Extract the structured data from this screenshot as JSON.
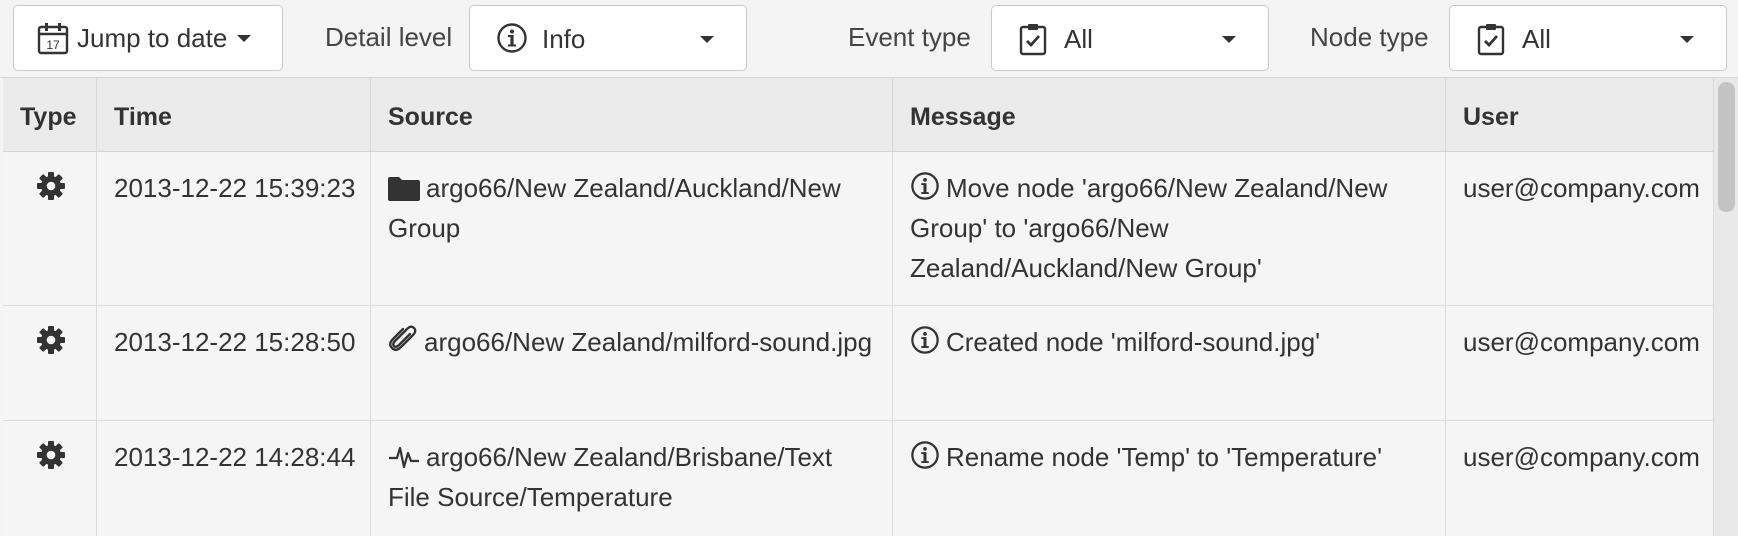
{
  "toolbar": {
    "jump_label": "Jump to date",
    "jump_icon_number": "17",
    "detail_level_label": "Detail level",
    "detail_level_value": "Info",
    "event_type_label": "Event type",
    "event_type_value": "All",
    "node_type_label": "Node type",
    "node_type_value": "All"
  },
  "table": {
    "headers": {
      "type": "Type",
      "time": "Time",
      "source": "Source",
      "message": "Message",
      "user": "User"
    },
    "rows": [
      {
        "type_icon": "gear-icon",
        "time": "2013-12-22 15:39:23",
        "source_icon": "folder-icon",
        "source": "argo66/New Zealand/Auckland/New Group",
        "message_icon": "info-icon",
        "message": "Move node 'argo66/New Zealand/New Group' to 'argo66/New Zealand/Auckland/New Group'",
        "user": "user@company.com"
      },
      {
        "type_icon": "gear-icon",
        "time": "2013-12-22 15:28:50",
        "source_icon": "paperclip-icon",
        "source": "argo66/New Zealand/milford-sound.jpg",
        "message_icon": "info-icon",
        "message": "Created node 'milford-sound.jpg'",
        "user": "user@company.com"
      },
      {
        "type_icon": "gear-icon",
        "time": "2013-12-22 14:28:44",
        "source_icon": "pulse-icon",
        "source": "argo66/New Zealand/Brisbane/Text File Source/Temperature",
        "message_icon": "info-icon",
        "message": "Rename node 'Temp' to 'Temperature'",
        "user": "user@company.com"
      }
    ]
  },
  "colors": {
    "background": "#f4f4f4",
    "header_bg": "#ebebeb",
    "border": "#d9d9d9",
    "text": "#333333"
  }
}
